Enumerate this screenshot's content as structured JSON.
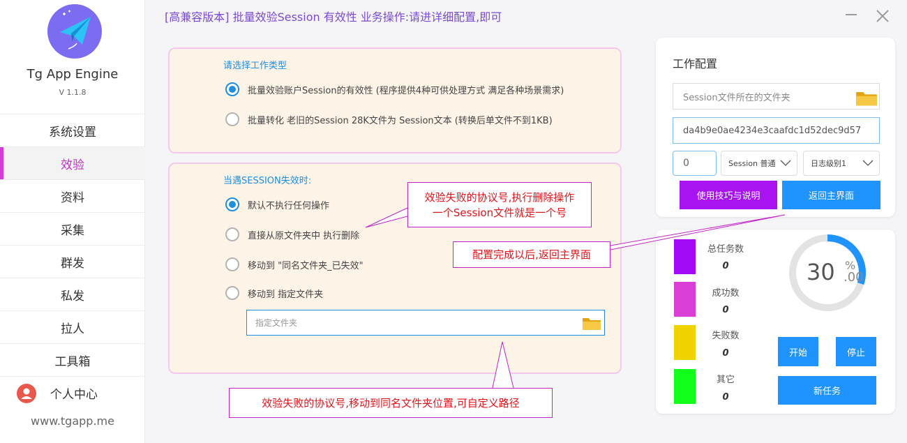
{
  "sidebar": {
    "app_name": "Tg App Engine",
    "version": "V 1.1.8",
    "items": [
      {
        "label": "系统设置"
      },
      {
        "label": "效验"
      },
      {
        "label": "资料"
      },
      {
        "label": "采集"
      },
      {
        "label": "群发"
      },
      {
        "label": "私发"
      },
      {
        "label": "拉人"
      },
      {
        "label": "工具箱"
      },
      {
        "label": "个人中心"
      }
    ],
    "active_index": 1,
    "site": "www.tgapp.me"
  },
  "window": {
    "title": "[高兼容版本] 批量效验Session 有效性 业务操作:请进详细配置,即可"
  },
  "work_type": {
    "heading": "请选择工作类型",
    "options": [
      {
        "label": "批量效验账户Session的有效性 (程序提供4种可供处理方式 满足各种场景需求)",
        "checked": true
      },
      {
        "label": "批量转化 老旧的Session 28K文件为 Session文本 (转换后单文件不到1KB)",
        "checked": false
      }
    ]
  },
  "on_invalid": {
    "heading": "当遇SESSION失效时:",
    "options": [
      {
        "label": "默认不执行任何操作",
        "checked": true
      },
      {
        "label": "直接从原文件夹中 执行删除",
        "checked": false
      },
      {
        "label": "移动到 \"同名文件夹_已失效\"",
        "checked": false
      },
      {
        "label": "移动到 指定文件夹",
        "checked": false
      }
    ],
    "folder_placeholder": "指定文件夹"
  },
  "config": {
    "title": "工作配置",
    "session_folder_placeholder": "Session文件所在的文件夹",
    "key_value": "da4b9e0ae4234e3caafdc1d52dec9d57",
    "count_value": "0",
    "session_mode": "Session 普通",
    "log_level": "日志级别1",
    "tips_button": "使用技巧与说明",
    "back_button": "返回主界面"
  },
  "stats": {
    "items": [
      {
        "label": "总任务数",
        "value": "0",
        "color": "#a20af5"
      },
      {
        "label": "成功数",
        "value": "0",
        "color": "#d93fd4"
      },
      {
        "label": "失败数",
        "value": "0",
        "color": "#f0d400"
      },
      {
        "label": "其它",
        "value": "0",
        "color": "#11ff1b"
      }
    ],
    "progress_value": "30",
    "progress_percent_sign": "%",
    "progress_decimal": ".00",
    "progress": 0.3,
    "start_button": "开始",
    "stop_button": "停止",
    "new_task_button": "新任务"
  },
  "annotations": {
    "delete_note_line1": "效验失败的协议号,执行删除操作",
    "delete_note_line2": "一个Session文件就是一个号",
    "back_note": "配置完成以后,返回主界面",
    "move_note": "效验失败的协议号,移动到同名文件夹位置,可自定义路径"
  },
  "colors": {
    "accent_blue": "#1f94ff",
    "accent_purple": "#a913f1",
    "active_nav": "#d43bd8",
    "annotation_text": "#e0151a"
  }
}
